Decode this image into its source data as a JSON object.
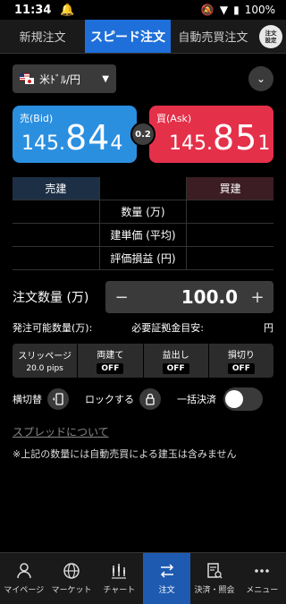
{
  "status": {
    "time": "11:34",
    "battery": "100%"
  },
  "tabs": [
    {
      "label": "新規注文"
    },
    {
      "label": "スピード注文"
    },
    {
      "label": "自動売買注文"
    }
  ],
  "order_settings": {
    "line1": "注文",
    "line2": "設定"
  },
  "pair": {
    "label": "米ﾄﾞﾙ/円"
  },
  "bid": {
    "label": "売(Bid)",
    "prefix": "145.",
    "big": "84",
    "tail": "4"
  },
  "ask": {
    "label": "買(Ask)",
    "prefix": "145.",
    "big": "85",
    "tail": "1"
  },
  "spread": "0.2",
  "position_table": {
    "sell_header": "売建",
    "buy_header": "買建",
    "rows": [
      "数量 (万)",
      "建単価 (平均)",
      "評価損益 (円)"
    ]
  },
  "order_qty": {
    "label": "注文数量 (万)",
    "value": "100.0",
    "minus": "−",
    "plus": "+"
  },
  "info": {
    "available": "発注可能数量(万):",
    "margin": "必要証拠金目安:",
    "unit": "円"
  },
  "options": [
    {
      "label": "スリッページ",
      "value": "20.0 pips"
    },
    {
      "label": "両建て",
      "value": "OFF"
    },
    {
      "label": "益出し",
      "value": "OFF"
    },
    {
      "label": "損切り",
      "value": "OFF"
    }
  ],
  "toggles": {
    "orientation": "横切替",
    "lock": "ロックする",
    "bulk": "一括決済"
  },
  "spread_link": "スプレッドについて",
  "note": "※上記の数量には自動売買による建玉は含みません",
  "bottom_nav": [
    {
      "label": "マイページ",
      "icon": "person-icon"
    },
    {
      "label": "マーケット",
      "icon": "globe-icon"
    },
    {
      "label": "チャート",
      "icon": "chart-icon"
    },
    {
      "label": "注文",
      "icon": "order-arrows-icon"
    },
    {
      "label": "決済・照会",
      "icon": "document-search-icon"
    },
    {
      "label": "メニュー",
      "icon": "more-icon"
    }
  ],
  "colors": {
    "bid": "#2b8fe0",
    "ask": "#e5304a",
    "active_tab": "#1e6fd9",
    "active_nav": "#1e5bb0"
  }
}
